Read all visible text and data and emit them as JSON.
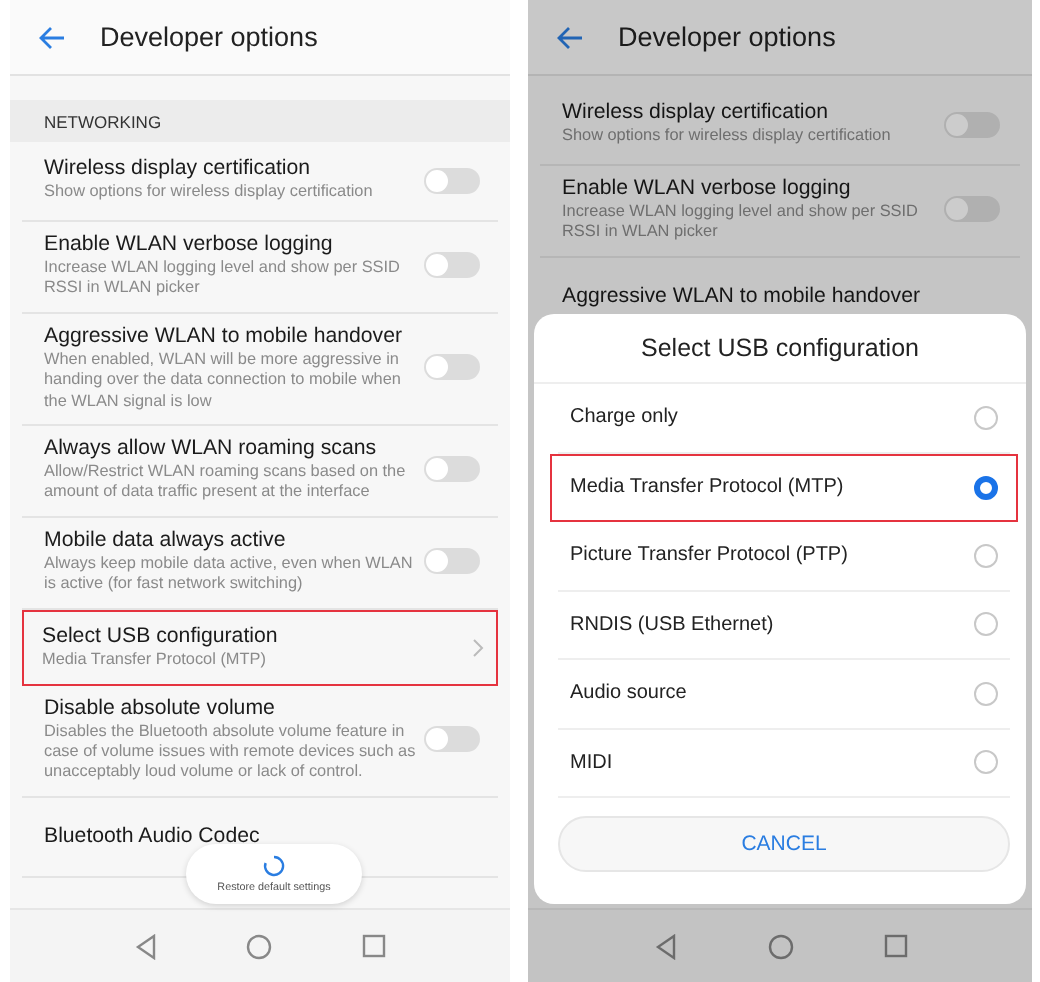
{
  "left_screen": {
    "title": "Developer options",
    "section": "NETWORKING",
    "settings": [
      {
        "kind": "toggle",
        "title": "Wireless display certification",
        "subtitle": "Show options for wireless display certification",
        "on": false,
        "highlighted": false
      },
      {
        "kind": "toggle",
        "title": "Enable WLAN verbose logging",
        "subtitle": "Increase WLAN logging level and show per SSID RSSI in WLAN picker",
        "on": false,
        "highlighted": false
      },
      {
        "kind": "toggle",
        "title": "Aggressive WLAN to mobile handover",
        "subtitle": "When enabled, WLAN will be more aggressive in handing over the data connection to mobile when the WLAN signal is low",
        "on": false,
        "highlighted": false
      },
      {
        "kind": "toggle",
        "title": "Always allow WLAN roaming scans",
        "subtitle": "Allow/Restrict WLAN roaming scans based on the amount of data traffic present at the interface",
        "on": false,
        "highlighted": false
      },
      {
        "kind": "toggle",
        "title": "Mobile data always active",
        "subtitle": "Always keep mobile data active, even when WLAN is active (for fast network switching)",
        "on": false,
        "highlighted": false
      },
      {
        "kind": "link",
        "title": "Select USB configuration",
        "subtitle": "Media Transfer Protocol (MTP)",
        "highlighted": true
      },
      {
        "kind": "toggle",
        "title": "Disable absolute volume",
        "subtitle": "Disables the Bluetooth absolute volume feature in case of volume issues with remote devices such as unacceptably loud volume or lack of control.",
        "on": false,
        "highlighted": false
      },
      {
        "kind": "link",
        "title": "Bluetooth Audio Codec",
        "highlighted": false
      }
    ],
    "restore_button": "Restore default settings"
  },
  "right_screen": {
    "title": "Developer options",
    "settings": [
      {
        "kind": "toggle",
        "title": "Wireless display certification",
        "subtitle": "Show options for wireless display certification",
        "on": false
      },
      {
        "kind": "toggle",
        "title": "Enable WLAN verbose logging",
        "subtitle": "Increase WLAN logging level and show per SSID RSSI in WLAN picker",
        "on": false
      },
      {
        "kind": "link",
        "title": "Aggressive WLAN to mobile handover"
      }
    ],
    "dialog": {
      "title": "Select USB configuration",
      "options": [
        {
          "label": "Charge only",
          "selected": false,
          "highlighted": false
        },
        {
          "label": "Media Transfer Protocol (MTP)",
          "selected": true,
          "highlighted": true
        },
        {
          "label": "Picture Transfer Protocol (PTP)",
          "selected": false,
          "highlighted": false
        },
        {
          "label": "RNDIS (USB Ethernet)",
          "selected": false,
          "highlighted": false
        },
        {
          "label": "Audio source",
          "selected": false,
          "highlighted": false
        },
        {
          "label": "MIDI",
          "selected": false,
          "highlighted": false
        }
      ],
      "cancel": "CANCEL"
    }
  }
}
